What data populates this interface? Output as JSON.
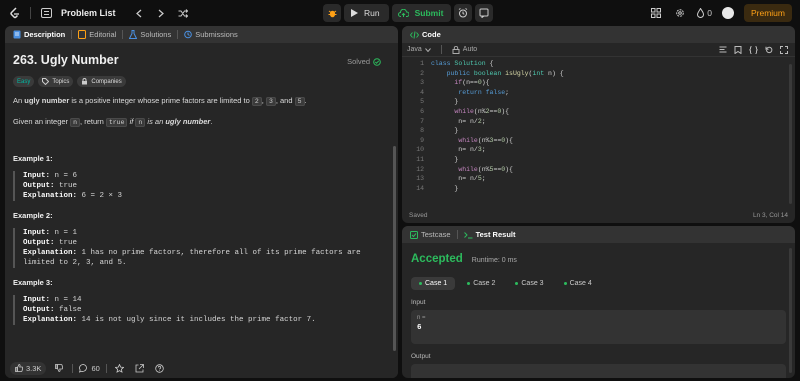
{
  "topbar": {
    "problem_list": "Problem List",
    "run": "Run",
    "submit": "Submit",
    "fire_count": "0",
    "premium": "Premium"
  },
  "desc_tabs": [
    "Description",
    "Editorial",
    "Solutions",
    "Submissions"
  ],
  "problem": {
    "title": "263. Ugly Number",
    "solved": "Solved",
    "tags": [
      "Easy",
      "Topics",
      "Companies"
    ],
    "p1_pre": "An ",
    "p1_bold": "ugly number",
    "p1_mid": " is a positive integer whose prime factors are limited to ",
    "p1_c1": "2",
    "p1_c2": "3",
    "p1_and": ", and ",
    "p1_c3": "5",
    "p2_pre": "Given an integer ",
    "p2_c1": "n",
    "p2_mid": ", return ",
    "p2_c2": "true",
    "p2_if": " if ",
    "p2_c3": "n",
    "p2_is": " is an ",
    "p2_bold": "ugly number"
  },
  "examples": [
    {
      "title": "Example 1:",
      "input": "n = 6",
      "output": "true",
      "explanation": "6 = 2 × 3"
    },
    {
      "title": "Example 2:",
      "input": "n = 1",
      "output": "true",
      "explanation": "1 has no prime factors, therefore all of its prime factors are\nlimited to 2, 3, and 5."
    },
    {
      "title": "Example 3:",
      "input": "n = 14",
      "output": "false",
      "explanation": "14 is not ugly since it includes the prime factor 7."
    }
  ],
  "labels": {
    "input": "Input:",
    "output": "Output:",
    "explanation": "Explanation:"
  },
  "desc_footer": {
    "likes": "3.3K",
    "comments": "60"
  },
  "code_panel": {
    "tab": "Code",
    "language": "Java",
    "auto": "Auto",
    "status": "Saved",
    "cursor": "Ln 3, Col 14"
  },
  "code_lines": [
    "class Solution {",
    "    public boolean isUgly(int n) {",
    "      if(n==0){",
    "       return false;",
    "      }",
    "      while(n%2==0){",
    "       n= n/2;",
    "      }",
    "       while(n%3==0){",
    "       n= n/3;",
    "      }",
    "       while(n%5==0){",
    "       n= n/5;",
    "      }"
  ],
  "test_panel": {
    "tabs": [
      "Testcase",
      "Test Result"
    ],
    "verdict": "Accepted",
    "runtime": "Runtime: 0 ms",
    "cases": [
      "Case 1",
      "Case 2",
      "Case 3",
      "Case 4"
    ],
    "input_label": "Input",
    "var_name": "n =",
    "var_value": "6",
    "output_label": "Output"
  },
  "colors": {
    "accent_green": "#2cbb5d",
    "premium": "#ffa116",
    "easy": "#00b8a3"
  }
}
